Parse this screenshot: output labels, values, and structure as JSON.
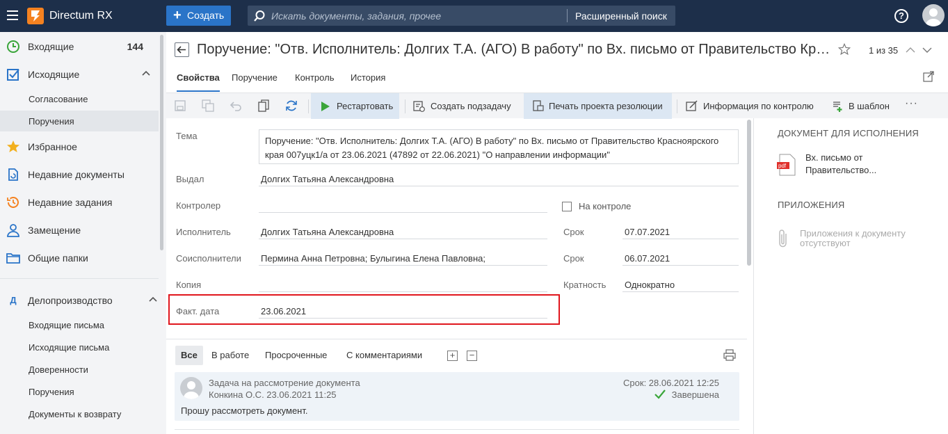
{
  "app": {
    "name": "Directum RX",
    "create_label": "Создать",
    "search_placeholder": "Искать документы, задания, прочее",
    "advanced_search": "Расширенный поиск",
    "help": "?"
  },
  "sidebar": {
    "items": [
      {
        "label": "Входящие",
        "count": "144",
        "icon": "clock-icon"
      },
      {
        "label": "Исходящие",
        "icon": "checkbox-icon"
      },
      {
        "label": "Согласование"
      },
      {
        "label": "Поручения"
      },
      {
        "label": "Избранное",
        "icon": "star-icon"
      },
      {
        "label": "Недавние документы",
        "icon": "document-refresh-icon"
      },
      {
        "label": "Недавние задания",
        "icon": "history-icon"
      },
      {
        "label": "Замещение",
        "icon": "user-icon"
      },
      {
        "label": "Общие папки",
        "icon": "folder-icon"
      }
    ],
    "section": {
      "label": "Делопроизводство",
      "letter": "Д",
      "items": [
        "Входящие письма",
        "Исходящие письма",
        "Доверенности",
        "Поручения",
        "Документы к возврату"
      ]
    }
  },
  "document": {
    "title": "Поручение: \"Отв. Исполнитель: Долгих Т.А. (АГО) В работу\" по Вх. письмо от Правительство Красноярского края",
    "pager": "1 из 35",
    "tabs": [
      "Свойства",
      "Поручение",
      "Контроль",
      "История"
    ],
    "toolbar": {
      "restart": "Рестартовать",
      "create_subtask": "Создать подзадачу",
      "print_resolution": "Печать проекта резолюции",
      "control_info": "Информация по контролю",
      "to_template": "В шаблон",
      "more": "···"
    }
  },
  "form": {
    "theme_label": "Тема",
    "theme_value": "Поручение: \"Отв. Исполнитель: Долгих Т.А. (АГО) В работу\" по Вх. письмо от Правительство Красноярского края 007уцк1/а от 23.06.2021 (47892 от 22.06.2021) \"О направлении информации\"",
    "issued_label": "Выдал",
    "issued_value": "Долгих Татьяна Александровна",
    "controller_label": "Контролер",
    "controller_value": "",
    "on_control_label": "На контроле",
    "executor_label": "Исполнитель",
    "executor_value": "Долгих Татьяна Александровна",
    "deadline_label": "Срок",
    "deadline_value": "07.07.2021",
    "coexecutors_label": "Соисполнители",
    "coexecutors_value": "Пермина Анна Петровна;  Булыгина Елена Павловна;",
    "deadline2_label": "Срок",
    "deadline2_value": "06.07.2021",
    "copy_label": "Копия",
    "copy_value": "",
    "frequency_label": "Кратность",
    "frequency_value": "Однократно",
    "fact_date_label": "Факт. дата",
    "fact_date_value": "23.06.2021"
  },
  "right_panel": {
    "doc_heading": "ДОКУМЕНТ ДЛЯ ИСПОЛНЕНИЯ",
    "doc_name_line1": "Вх. письмо от",
    "doc_name_line2": "Правительство...",
    "doc_icon": "pdf",
    "attachments_heading": "ПРИЛОЖЕНИЯ",
    "attachments_empty_line1": "Приложения к документу",
    "attachments_empty_line2": "отсутствуют"
  },
  "task_list": {
    "tabs": [
      "Все",
      "В работе",
      "Просроченные",
      "С комментариями"
    ],
    "task": {
      "title": "Задача на рассмотрение документа",
      "author": "Конкина О.С.  23.06.2021 11:25",
      "due": "Срок: 28.06.2021 12:25",
      "status": "Завершена",
      "text": "Прошу рассмотреть документ."
    }
  },
  "colors": {
    "topbar": "#1d2f4a",
    "accent": "#2a74c8",
    "logo": "#f58220",
    "highlight_frame": "#e0161d",
    "done": "#3aa53a"
  }
}
